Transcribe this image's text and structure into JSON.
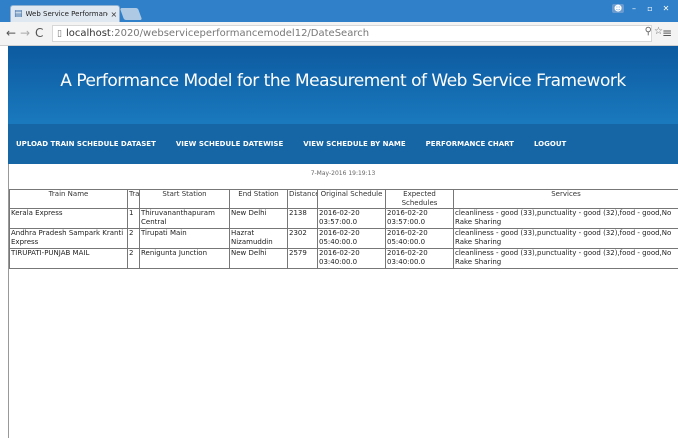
{
  "browser": {
    "tab_title": "Web Service Performance",
    "tab_close": "×",
    "url_host": "localhost",
    "url_path": ":2020/webserviceperformancemodel12/DateSearch",
    "icons": [
      "back-icon",
      "forward-icon",
      "reload-icon",
      "page-icon",
      "zoom-icon",
      "star-icon",
      "menu-icon"
    ]
  },
  "header": {
    "title": "A Performance Model for the Measurement of Web Service Framework"
  },
  "nav": {
    "items": [
      "UPLOAD TRAIN SCHEDULE DATASET",
      "VIEW SCHEDULE DATEWISE",
      "VIEW SCHEDULE BY NAME",
      "PERFORMANCE CHART",
      "LOGOUT"
    ]
  },
  "date_text": "7-May-2016 19:19:13",
  "table": {
    "headers": [
      "Train Name",
      "Track",
      "Start Station",
      "End Station",
      "Distance",
      "Original Schedule",
      "Expected Schedules",
      "Services"
    ],
    "rows": [
      [
        "Kerala Express",
        "1",
        "Thiruvananthapuram Central",
        "New Delhi",
        "2138",
        "2016-02-20 03:57:00.0",
        "2016-02-20 03:57:00.0",
        "cleanliness - good (33),punctuality - good (32),food - good,No Rake Sharing"
      ],
      [
        "Andhra Pradesh Sampark Kranti Express",
        "2",
        "Tirupati Main",
        "Hazrat Nizamuddin",
        "2302",
        "2016-02-20 05:40:00.0",
        "2016-02-20 05:40:00.0",
        "cleanliness - good (33),punctuality - good (32),food - good,No Rake Sharing"
      ],
      [
        "TIRUPATI-PUNJAB MAIL",
        "2",
        "Renigunta Junction",
        "New Delhi",
        "2579",
        "2016-02-20 03:40:00.0",
        "2016-02-20 03:40:00.0",
        "cleanliness - good (33),punctuality - good (32),food - good,No Rake Sharing"
      ]
    ]
  }
}
